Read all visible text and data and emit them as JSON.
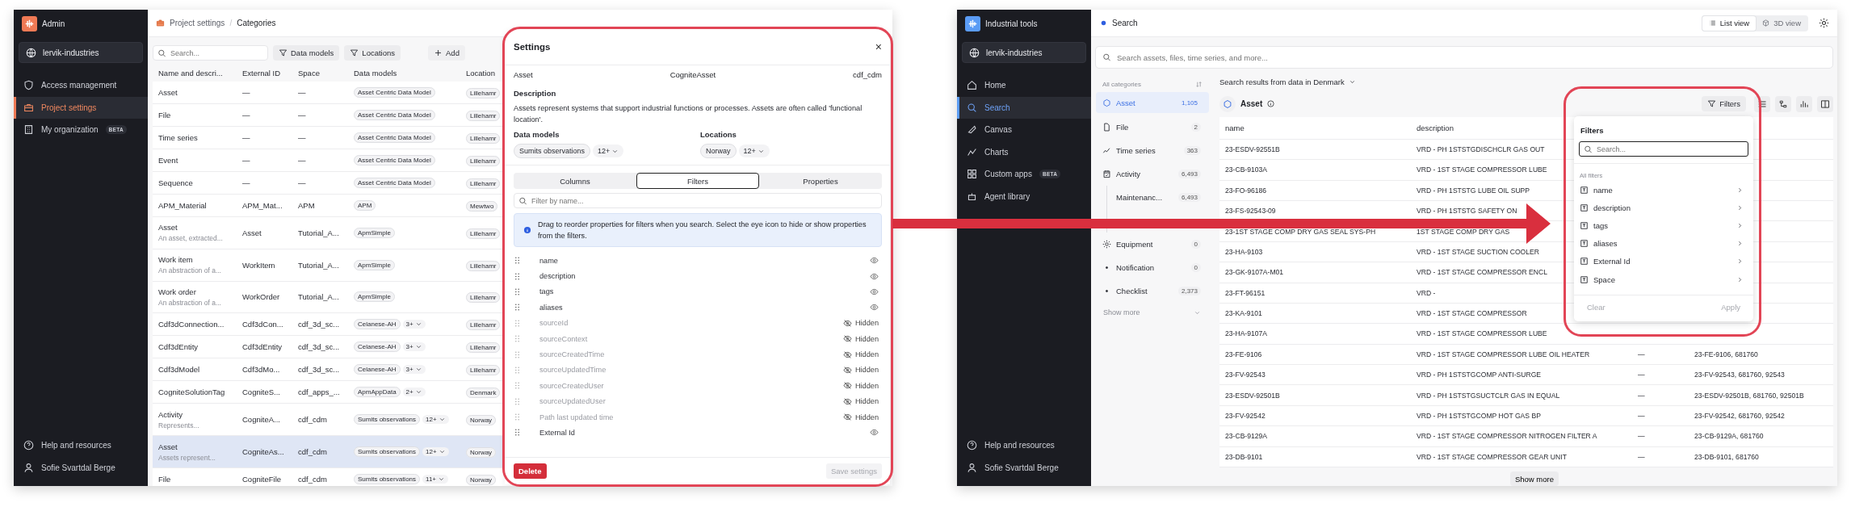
{
  "admin_app": {
    "app_title": "Admin",
    "workspace": "lervik-industries",
    "nav": [
      {
        "label": "Access management",
        "selected": false
      },
      {
        "label": "Project settings",
        "selected": true
      },
      {
        "label": "My organization",
        "badge": "BETA",
        "selected": false
      }
    ],
    "footer_nav": [
      "Help and resources",
      "Sofie Svartdal Berge"
    ],
    "breadcrumb": [
      "Project settings",
      "Categories"
    ],
    "breadcrumb_separator": "/",
    "toolbar": {
      "search_placeholder": "Search...",
      "filters": [
        "Data models",
        "Locations"
      ],
      "add": "Add"
    },
    "table": {
      "columns": [
        "Name and descri...",
        "External ID",
        "Space",
        "Data models",
        "Location"
      ],
      "rows": [
        {
          "name": "Asset",
          "external_id": "—",
          "space": "—",
          "data_model": "Asset Centric Data Model",
          "location": "Lillehamr",
          "selected": false
        },
        {
          "name": "File",
          "external_id": "—",
          "space": "—",
          "data_model": "Asset Centric Data Model",
          "location": "Lillehamr",
          "selected": false
        },
        {
          "name": "Time series",
          "external_id": "—",
          "space": "—",
          "data_model": "Asset Centric Data Model",
          "location": "Lillehamr",
          "selected": false
        },
        {
          "name": "Event",
          "external_id": "—",
          "space": "—",
          "data_model": "Asset Centric Data Model",
          "location": "Lillehamr",
          "selected": false
        },
        {
          "name": "Sequence",
          "external_id": "—",
          "space": "—",
          "data_model": "Asset Centric Data Model",
          "location": "Lillehamr",
          "selected": false
        },
        {
          "name": "APM_Material",
          "external_id": "APM_Mat...",
          "space": "APM",
          "data_model": "APM",
          "location": "Mewtwo",
          "selected": false
        },
        {
          "name": "Asset",
          "description": "An asset, extracted...",
          "external_id": "Asset",
          "space": "Tutorial_A...",
          "data_model": "ApmSimple",
          "location": "Lillehamr",
          "selected": false
        },
        {
          "name": "Work item",
          "description": "An abstraction of a...",
          "external_id": "WorkItem",
          "space": "Tutorial_A...",
          "data_model": "ApmSimple",
          "location": "Lillehamr",
          "selected": false
        },
        {
          "name": "Work order",
          "description": "An abstraction of a...",
          "external_id": "WorkOrder",
          "space": "Tutorial_A...",
          "data_model": "ApmSimple",
          "location": "Lillehamr",
          "selected": false
        },
        {
          "name": "Cdf3dConnection...",
          "external_id": "Cdf3dCon...",
          "space": "cdf_3d_sc...",
          "data_model": "Celanese-AH",
          "more": "3+",
          "location": "Lillehamr",
          "selected": false
        },
        {
          "name": "Cdf3dEntity",
          "external_id": "Cdf3dEntity",
          "space": "cdf_3d_sc...",
          "data_model": "Celanese-AH",
          "more": "3+",
          "location": "Lillehamr",
          "selected": false
        },
        {
          "name": "Cdf3dModel",
          "external_id": "Cdf3dMo...",
          "space": "cdf_3d_sc...",
          "data_model": "Celanese-AH",
          "more": "3+",
          "location": "Lillehamr",
          "selected": false
        },
        {
          "name": "CogniteSolutionTag",
          "external_id": "CogniteS...",
          "space": "cdf_apps_...",
          "data_model": "ApmAppData",
          "more": "2+",
          "location": "Denmark",
          "selected": false
        },
        {
          "name": "Activity",
          "description": "Represents...",
          "external_id": "CogniteA...",
          "space": "cdf_cdm",
          "data_model": "Sumits observations",
          "more": "12+",
          "location": "Norway",
          "selected": false
        },
        {
          "name": "Asset",
          "description": "Assets represent...",
          "external_id": "CogniteAs...",
          "space": "cdf_cdm",
          "data_model": "Sumits observations",
          "more": "12+",
          "location": "Norway",
          "selected": true
        },
        {
          "name": "File",
          "external_id": "CogniteFile",
          "space": "cdf_cdm",
          "data_model": "Sumits observations",
          "more": "11+",
          "location": "Norway",
          "selected": false
        }
      ]
    },
    "settings": {
      "title": "Settings",
      "close": "×",
      "meta": [
        "Asset",
        "CogniteAsset",
        "cdf_cdm"
      ],
      "description_label": "Description",
      "description": "Assets represent systems that support industrial functions or processes. Assets are often called 'functional location'.",
      "data_models": {
        "label": "Data models",
        "value": "Sumits observations",
        "more": "12+"
      },
      "locations": {
        "label": "Locations",
        "value": "Norway",
        "more": "12+"
      },
      "tabs": [
        {
          "label": "Columns",
          "selected": false
        },
        {
          "label": "Filters",
          "selected": true
        },
        {
          "label": "Properties",
          "selected": false
        }
      ],
      "filter_placeholder": "Filter by name...",
      "info": "Drag to reorder properties for filters when you search. Select the eye icon to hide or show properties from the filters.",
      "properties": [
        {
          "name": "name",
          "visible": true
        },
        {
          "name": "description",
          "visible": true
        },
        {
          "name": "tags",
          "visible": true
        },
        {
          "name": "aliases",
          "visible": true
        },
        {
          "name": "sourceId",
          "visible": false,
          "status": "Hidden"
        },
        {
          "name": "sourceContext",
          "visible": false,
          "status": "Hidden"
        },
        {
          "name": "sourceCreatedTime",
          "visible": false,
          "status": "Hidden"
        },
        {
          "name": "sourceUpdatedTime",
          "visible": false,
          "status": "Hidden"
        },
        {
          "name": "sourceCreatedUser",
          "visible": false,
          "status": "Hidden"
        },
        {
          "name": "sourceUpdatedUser",
          "visible": false,
          "status": "Hidden"
        },
        {
          "name": "Path last updated time",
          "visible": false,
          "status": "Hidden"
        },
        {
          "name": "External Id",
          "visible": true
        }
      ],
      "delete": "Delete",
      "save": {
        "label": "Save settings",
        "disabled": true
      }
    }
  },
  "tools_app": {
    "app_title": "Industrial tools",
    "workspace": "lervik-industries",
    "nav": [
      {
        "label": "Home",
        "selected": false
      },
      {
        "label": "Search",
        "selected": true
      },
      {
        "label": "Canvas",
        "selected": false
      },
      {
        "label": "Charts",
        "selected": false
      },
      {
        "label": "Custom apps",
        "badge": "BETA",
        "selected": false
      },
      {
        "label": "Agent library",
        "selected": false
      }
    ],
    "footer_nav": [
      "Help and resources",
      "Sofie Svartdal Berge"
    ],
    "page_title": "Search",
    "views": [
      {
        "label": "List view",
        "selected": true
      },
      {
        "label": "3D view",
        "selected": false
      }
    ],
    "search_placeholder": "Search assets, files, time series, and more...",
    "categories_label": "All categories",
    "categories": [
      {
        "label": "Asset",
        "count": "1,105",
        "selected": true
      },
      {
        "label": "File",
        "count": "2",
        "selected": false
      },
      {
        "label": "Time series",
        "count": "363",
        "selected": false
      },
      {
        "label": "Activity",
        "count": "6,493",
        "selected": false,
        "children": [
          {
            "label": "Maintenanc...",
            "count": "6,493",
            "selected": false
          }
        ]
      },
      {
        "label": "Equipment",
        "count": "0",
        "selected": false
      },
      {
        "label": "Notification",
        "count": "0",
        "selected": false
      },
      {
        "label": "Checklist",
        "count": "2,373",
        "selected": false
      }
    ],
    "show_more_categories": "Show more",
    "results_scope": "Search results from data in Denmark",
    "results_type": "Asset",
    "filters_button": "Filters",
    "table": {
      "columns": [
        "name",
        "description"
      ],
      "rows": [
        {
          "name": "23-ESDV-92551B",
          "description": "VRD - PH 1STSTGDISCHCLR GAS OUT"
        },
        {
          "name": "23-CB-9103A",
          "description": "VRD - 1ST STAGE COMPRESSOR LUBE"
        },
        {
          "name": "23-FO-96186",
          "description": "VRD - PH 1STSTG LUBE OIL SUPP"
        },
        {
          "name": "23-FS-92543-09",
          "description": "VRD - PH 1STSTG SAFETY ON"
        },
        {
          "name": "23-1ST STAGE COMP DRY GAS SEAL SYS-PH",
          "description": "1ST STAGE COMP DRY GAS"
        },
        {
          "name": "23-HA-9103",
          "description": "VRD - 1ST STAGE SUCTION COOLER"
        },
        {
          "name": "23-GK-9107A-M01",
          "description": "VRD - 1ST STAGE COMPRESSOR ENCL"
        },
        {
          "name": "23-FT-96151",
          "description": "VRD -"
        },
        {
          "name": "23-KA-9101",
          "description": "VRD - 1ST STAGE COMPRESSOR"
        },
        {
          "name": "23-HA-9107A",
          "description": "VRD - 1ST STAGE COMPRESSOR LUBE"
        },
        {
          "name": "23-FE-9106",
          "description": "VRD - 1ST STAGE COMPRESSOR LUBE OIL HEATER",
          "column_3": "—",
          "ids": "23-FE-9106, 681760"
        },
        {
          "name": "23-FV-92543",
          "description": "VRD - PH 1STSTGCOMP ANTI-SURGE",
          "column_3": "—",
          "ids": "23-FV-92543, 681760, 92543"
        },
        {
          "name": "23-ESDV-92501B",
          "description": "VRD - PH 1STSTGSUCTCLR GAS IN EQUAL",
          "column_3": "—",
          "ids": "23-ESDV-92501B, 681760, 92501B"
        },
        {
          "name": "23-FV-92542",
          "description": "VRD - PH 1STSTGCOMP HOT GAS BP",
          "column_3": "—",
          "ids": "23-FV-92542, 681760, 92542"
        },
        {
          "name": "23-CB-9129A",
          "description": "VRD - 1ST STAGE COMPRESSOR NITROGEN FILTER A",
          "column_3": "—",
          "ids": "23-CB-9129A, 681760"
        },
        {
          "name": "23-DB-9101",
          "description": "VRD - 1ST STAGE COMPRESSOR GEAR UNIT",
          "column_3": "—",
          "ids": "23-DB-9101, 681760"
        }
      ]
    },
    "show_more": "Show more",
    "filters_popover": {
      "title": "Filters",
      "search_placeholder": "Search...",
      "section": "All filters",
      "items": [
        "name",
        "description",
        "tags",
        "aliases",
        "External Id",
        "Space"
      ],
      "clear": "Clear",
      "apply": "Apply"
    }
  }
}
